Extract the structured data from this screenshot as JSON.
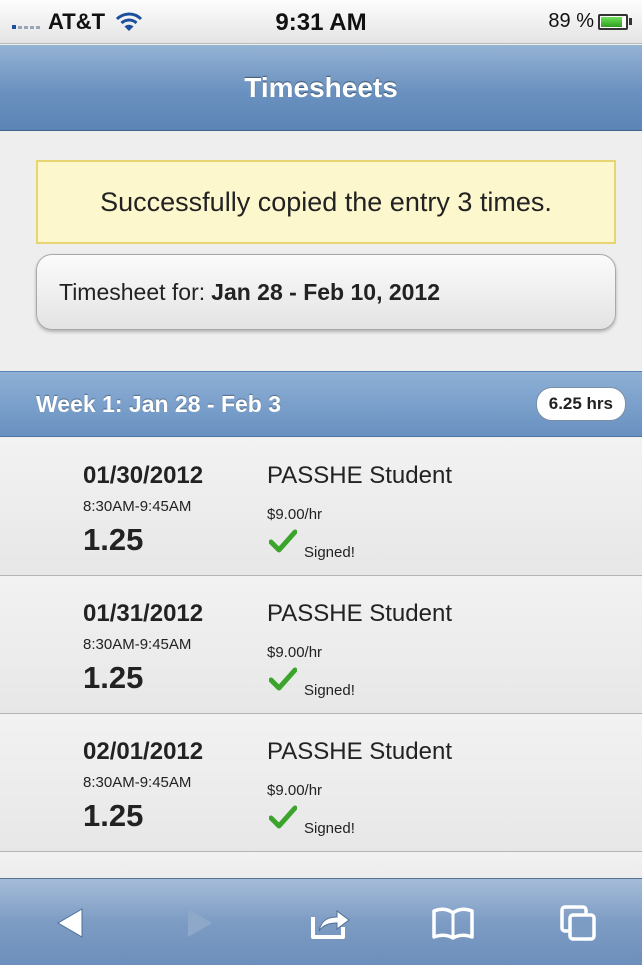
{
  "status_bar": {
    "carrier": "AT&T",
    "time": "9:31 AM",
    "battery_percent": "89 %",
    "battery_level": 0.89,
    "signal_icon": "signal-icon",
    "wifi_icon": "wifi-icon"
  },
  "navbar": {
    "title": "Timesheets"
  },
  "alert": {
    "message": "Successfully copied the entry 3 times."
  },
  "period": {
    "label": "Timesheet for:",
    "value": "Jan 28 - Feb 10, 2012"
  },
  "week": {
    "title": "Week 1: Jan 28 - Feb 3",
    "total": "6.25 hrs"
  },
  "entries": [
    {
      "date": "01/30/2012",
      "time": "8:30AM-9:45AM",
      "hours": "1.25",
      "job": "PASSHE Student",
      "rate": "$9.00/hr",
      "status": "Signed!"
    },
    {
      "date": "01/31/2012",
      "time": "8:30AM-9:45AM",
      "hours": "1.25",
      "job": "PASSHE Student",
      "rate": "$9.00/hr",
      "status": "Signed!"
    },
    {
      "date": "02/01/2012",
      "time": "8:30AM-9:45AM",
      "hours": "1.25",
      "job": "PASSHE Student",
      "rate": "$9.00/hr",
      "status": "Signed!"
    }
  ],
  "toolbar": {
    "icons": [
      "back-arrow-icon",
      "forward-arrow-icon",
      "share-icon",
      "bookmarks-icon",
      "tabs-icon"
    ]
  },
  "colors": {
    "navbar": "#6a91bf",
    "alert_bg": "#fcf7cd",
    "alert_border": "#e8d56f",
    "check": "#3aa52a"
  }
}
